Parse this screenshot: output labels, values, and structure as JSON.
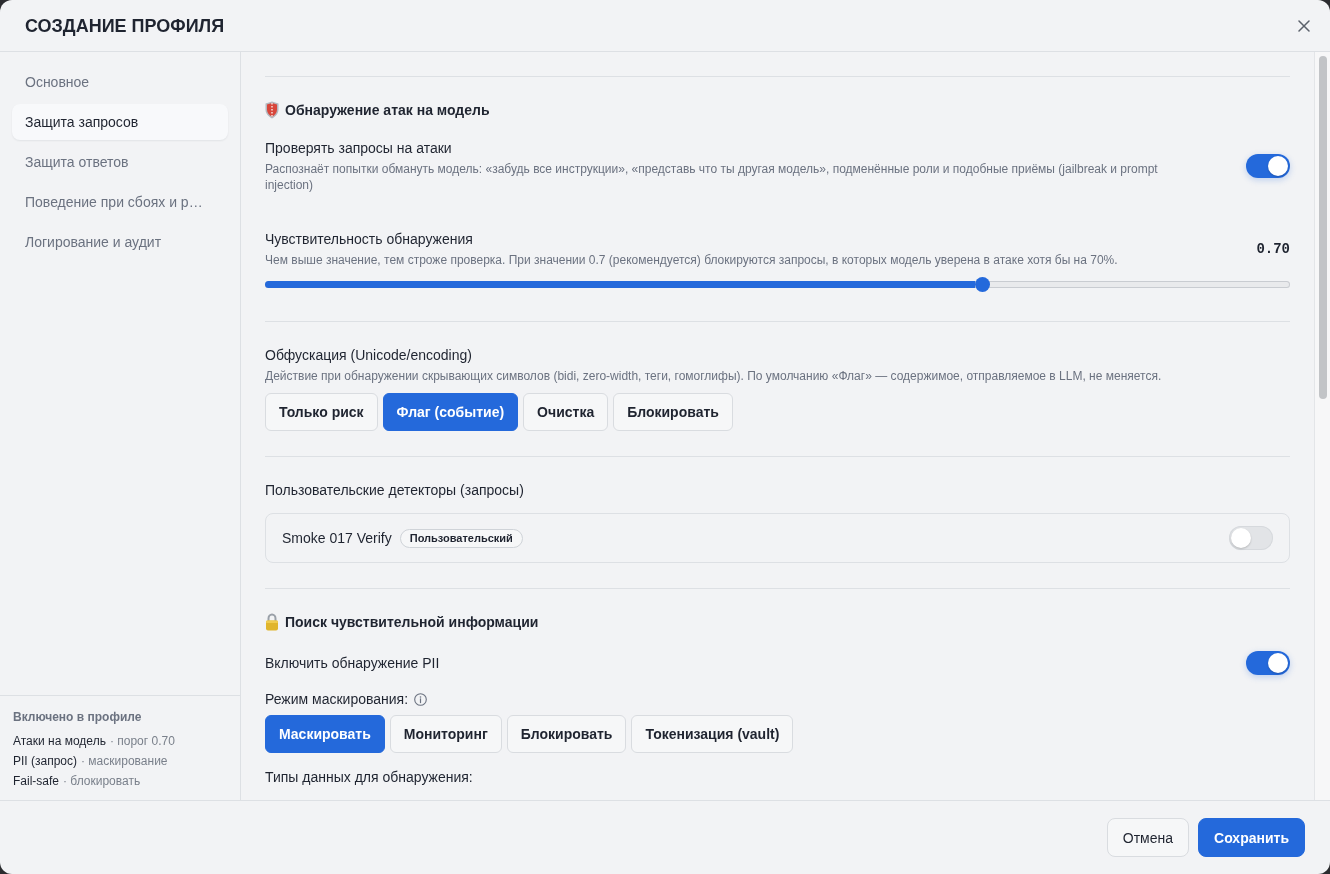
{
  "dialog": {
    "title": "СОЗДАНИЕ ПРОФИЛЯ"
  },
  "sidebar": {
    "items": [
      {
        "label": "Основное",
        "selected": false
      },
      {
        "label": "Защита запросов",
        "selected": true
      },
      {
        "label": "Защита ответов",
        "selected": false
      },
      {
        "label": "Поведение при сбоях и р…",
        "selected": false
      },
      {
        "label": "Логирование и аудит",
        "selected": false
      }
    ],
    "summary": {
      "title": "Включено в профиле",
      "lines": [
        {
          "name": "Атаки на модель",
          "detail": "· порог 0.70"
        },
        {
          "name": "PII (запрос)",
          "detail": "· маскирование"
        },
        {
          "name": "Fail-safe",
          "detail": "· блокировать"
        }
      ]
    }
  },
  "sections": [
    {
      "title": "Обнаружение атак на модель",
      "groups": [
        {
          "settings": [
            {
              "kind": "toggle",
              "label": "Проверять запросы на атаки",
              "description": "Распознаёт попытки обмануть модель: «забудь все инструкции», «представь что ты другая модель», подменённые роли и подобные приёмы (jailbreak и prompt injection)",
              "on": true
            },
            {
              "kind": "slider",
              "label": "Чувствительность обнаружения",
              "description": "Чем выше значение, тем строже проверка. При значении 0.7 (рекомендуется) блокируются запросы, в которых модель уверена в атаке хотя бы на 70%.",
              "reading": "0.70",
              "level": 0.7
            }
          ]
        },
        {
          "settings": [
            {
              "kind": "choice",
              "label": "Обфускация (Unicode/encoding)",
              "description": "Действие при обнаружении скрывающих символов (bidi, zero-width, теги, гомоглифы). По умолчанию «Флаг» — содержимое, отправляемое в LLM, не меняется.",
              "options": [
                {
                  "label": "Только риск",
                  "selected": false
                },
                {
                  "label": "Флаг (событие)",
                  "selected": true
                },
                {
                  "label": "Очистка",
                  "selected": false
                },
                {
                  "label": "Блокировать",
                  "selected": false
                }
              ]
            }
          ]
        },
        {
          "settings": [
            {
              "kind": "detectors",
              "label": "Пользовательские детекторы (запросы)",
              "items": [
                {
                  "name": "Smoke 017 Verify",
                  "badge": "Пользовательский",
                  "on": false
                }
              ]
            }
          ]
        }
      ]
    },
    {
      "title": "Поиск чувствительной информации",
      "groups": [
        {
          "settings": [
            {
              "kind": "toggle",
              "label": "Включить обнаружение PII",
              "on": true
            },
            {
              "kind": "choice",
              "label": "Режим маскирования:",
              "info": true,
              "options": [
                {
                  "label": "Маскировать",
                  "selected": true
                },
                {
                  "label": "Мониторинг",
                  "selected": false
                },
                {
                  "label": "Блокировать",
                  "selected": false
                },
                {
                  "label": "Токенизация (vault)",
                  "selected": false
                }
              ]
            },
            {
              "kind": "label",
              "label": "Типы данных для обнаружения:"
            }
          ]
        }
      ]
    }
  ],
  "footer": {
    "buttons": [
      {
        "label": "Отмена",
        "kind": "secondary"
      },
      {
        "label": "Сохранить",
        "kind": "primary"
      }
    ]
  }
}
